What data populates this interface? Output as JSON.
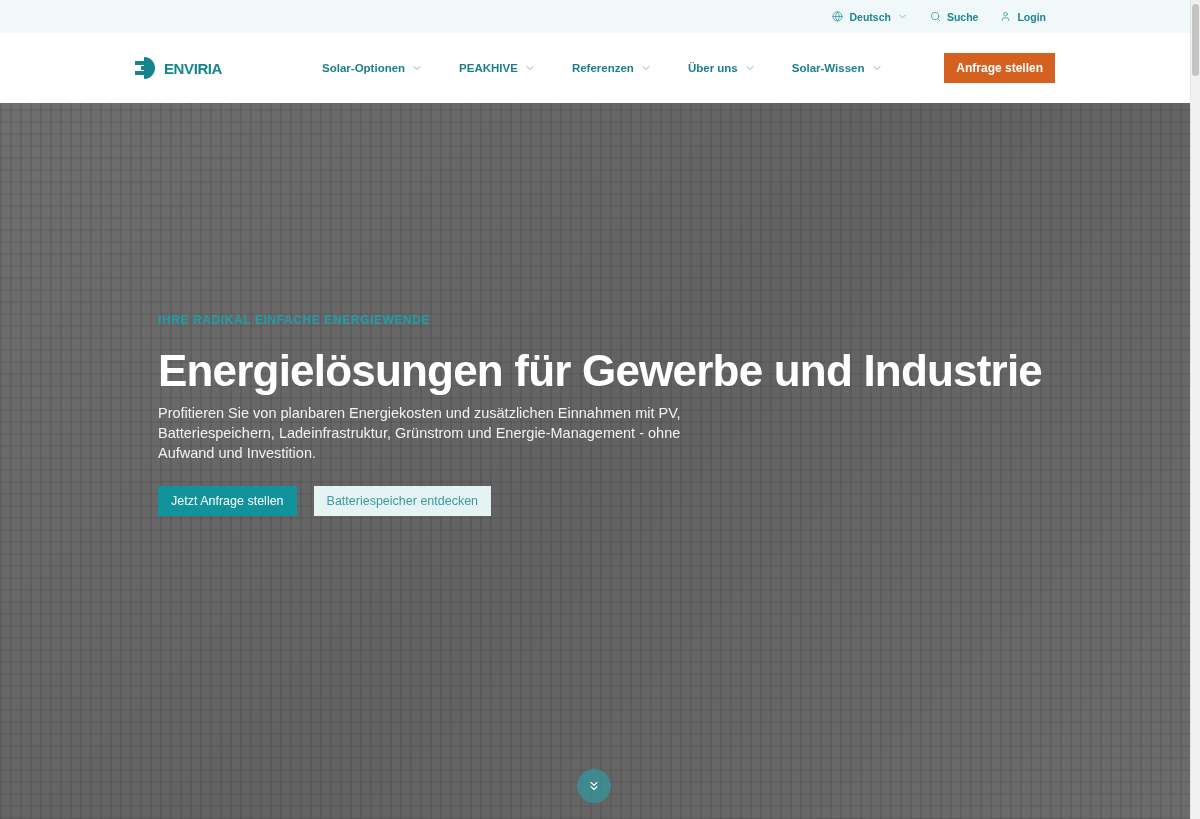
{
  "top_bar": {
    "items": [
      {
        "kind": "language",
        "label": "Deutsch",
        "dropdown": true
      },
      {
        "kind": "search",
        "label": "Suche",
        "dropdown": false
      },
      {
        "kind": "login",
        "label": "Login",
        "dropdown": false
      }
    ]
  },
  "header": {
    "logo": {
      "text": "ENVIRIA"
    },
    "nav": [
      {
        "label": "Solar-Optionen",
        "dropdown": true
      },
      {
        "label": "PEAKHIVE",
        "dropdown": true
      },
      {
        "label": "Referenzen",
        "dropdown": true
      },
      {
        "label": "Über uns",
        "dropdown": true
      },
      {
        "label": "Solar-Wissen",
        "dropdown": true
      }
    ],
    "cta": {
      "label": "Anfrage stellen"
    }
  },
  "hero": {
    "eyebrow": "IHRE RADIKAL EINFACHE ENERGIEWENDE",
    "title": "Energielösungen für Gewerbe und Industrie",
    "text": "Profitieren Sie von planbaren Energiekosten und zusätzlichen Einnahmen mit PV, Batteriespeichern, Ladeinfrastruktur, Grünstrom und Energie-Management - ohne Aufwand und Investition.",
    "buttons": [
      {
        "kind": "primary",
        "label": "Jetzt Anfrage stellen"
      },
      {
        "kind": "secondary",
        "label": "Batteriespeicher entdecken"
      }
    ]
  }
}
